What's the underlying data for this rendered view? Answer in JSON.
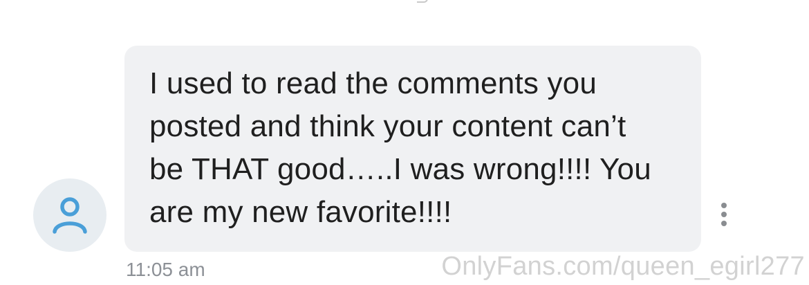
{
  "message": {
    "text": "I used to read the comments you\nposted and think your content can’t\nbe THAT good…..I was wrong!!!! You\nare my new favorite!!!!",
    "timestamp": "11:05 am"
  },
  "sender": {
    "avatar_icon": "user-icon",
    "avatar_color": "#4a9fd8",
    "avatar_background": "#e8edf1"
  },
  "actions": {
    "more_icon": "more-vertical-icon"
  },
  "watermark": "OnlyFans.com/queen_egirl277",
  "colors": {
    "bubble": "#f0f1f3",
    "text": "#1f1f1f",
    "timestamp": "#8c9096"
  }
}
